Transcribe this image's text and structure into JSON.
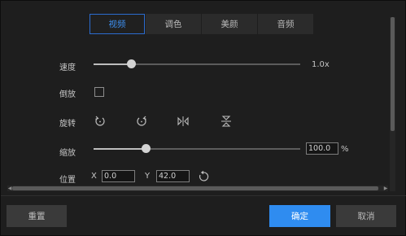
{
  "tabs": [
    {
      "label": "视频",
      "active": true
    },
    {
      "label": "调色",
      "active": false
    },
    {
      "label": "美颜",
      "active": false
    },
    {
      "label": "音频",
      "active": false
    }
  ],
  "speed": {
    "label": "速度",
    "value_text": "1.0x",
    "slider_fraction": 0.18
  },
  "reverse": {
    "label": "倒放",
    "checked": false
  },
  "rotate": {
    "label": "旋转",
    "icons": [
      "rotate-left-icon",
      "rotate-right-icon",
      "flip-horizontal-icon",
      "flip-vertical-icon"
    ]
  },
  "scale": {
    "label": "缩放",
    "value": "100.0",
    "unit": "%",
    "slider_fraction": 0.25
  },
  "position": {
    "label": "位置",
    "x_label": "X",
    "x_value": "0.0",
    "y_label": "Y",
    "y_value": "42.0",
    "reset_icon": "reset-position-icon"
  },
  "buttons": {
    "reset": "重置",
    "ok": "确定",
    "cancel": "取消"
  },
  "colors": {
    "accent": "#2f8cf0",
    "background": "#1e1e1e"
  }
}
